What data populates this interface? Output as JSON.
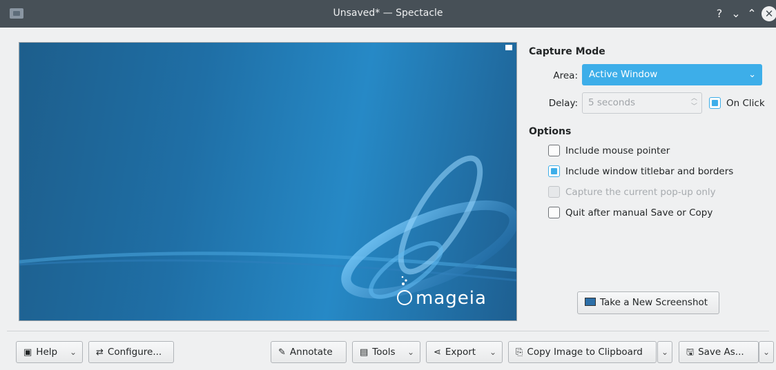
{
  "window": {
    "title": "Unsaved* — Spectacle",
    "help_glyph": "?",
    "minimize_glyph": "⌄",
    "maximize_glyph": "⌃",
    "close_glyph": "✕"
  },
  "preview": {
    "logo_text": "mageia",
    "accent": "#3daee9"
  },
  "capture_mode": {
    "heading": "Capture Mode",
    "area_label": "Area:",
    "area_value": "Active Window",
    "delay_label": "Delay:",
    "delay_value": "5 seconds",
    "on_click_label": "On Click",
    "on_click_checked": true
  },
  "options": {
    "heading": "Options",
    "items": [
      {
        "label": "Include mouse pointer",
        "checked": false,
        "enabled": true
      },
      {
        "label": "Include window titlebar and borders",
        "checked": true,
        "enabled": true
      },
      {
        "label": "Capture the current pop-up only",
        "checked": false,
        "enabled": false
      },
      {
        "label": "Quit after manual Save or Copy",
        "checked": false,
        "enabled": true
      }
    ]
  },
  "take_screenshot_label": "Take a New Screenshot",
  "footer": {
    "help": "Help",
    "configure": "Configure...",
    "annotate": "Annotate",
    "tools": "Tools",
    "export": "Export",
    "copy": "Copy Image to Clipboard",
    "save_as": "Save As..."
  },
  "colors": {
    "titlebar": "#475057",
    "background": "#eff0f1",
    "highlight": "#3daee9"
  }
}
